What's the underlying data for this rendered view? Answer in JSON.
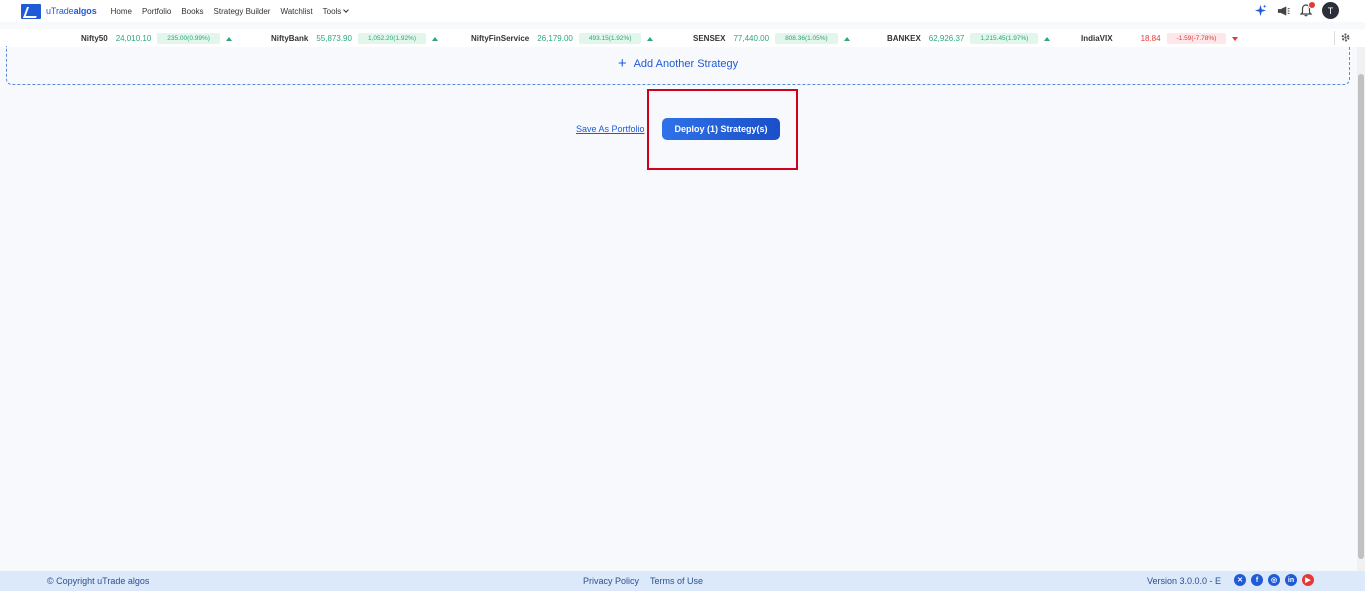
{
  "brand": {
    "logo_prefix": "uTrade",
    "logo_suffix": "algos",
    "color": "#1f5bd6"
  },
  "nav": {
    "items": [
      "Home",
      "Portfolio",
      "Books",
      "Strategy Builder",
      "Watchlist"
    ],
    "tools_label": "Tools",
    "avatar_initial": "T"
  },
  "ticker": [
    {
      "name": "Nifty50",
      "value": "24,010.10",
      "change": "235.00(0.99%)",
      "direction": "up"
    },
    {
      "name": "NiftyBank",
      "value": "55,873.90",
      "change": "1,052.20(1.92%)",
      "direction": "up"
    },
    {
      "name": "NiftyFinService",
      "value": "26,179.00",
      "change": "493.15(1.92%)",
      "direction": "up"
    },
    {
      "name": "SENSEX",
      "value": "77,440.00",
      "change": "808.36(1.05%)",
      "direction": "up"
    },
    {
      "name": "BANKEX",
      "value": "62,926.37",
      "change": "1,215.45(1.97%)",
      "direction": "up"
    },
    {
      "name": "IndiaVIX",
      "value": "18.84",
      "change": "-1.59(-7.78%)",
      "direction": "down"
    }
  ],
  "strategy": {
    "add_label": "Add Another Strategy"
  },
  "actions": {
    "save_portfolio": "Save As Portfolio",
    "deploy": "Deploy (1) Strategy(s)"
  },
  "footer": {
    "copyright": "© Copyright uTrade algos",
    "privacy": "Privacy Policy",
    "terms": "Terms of Use",
    "version": "Version 3.0.0.0 - E"
  },
  "colors": {
    "accent": "#1f5bd6",
    "positive": "#2aa876",
    "negative": "#e53935",
    "highlight": "#d0021b"
  }
}
